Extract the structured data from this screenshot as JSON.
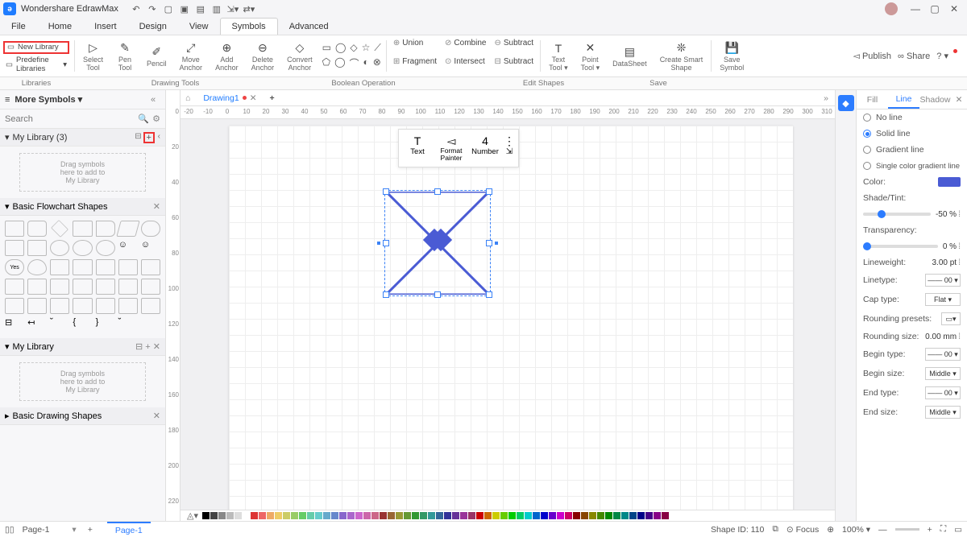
{
  "app": {
    "title": "Wondershare EdrawMax"
  },
  "menus": [
    "File",
    "Home",
    "Insert",
    "Design",
    "View",
    "Symbols",
    "Advanced"
  ],
  "active_menu": "Symbols",
  "publish": {
    "publish": "Publish",
    "share": "Share"
  },
  "libleft": {
    "new": "New Library",
    "predef": "Predefine Libraries",
    "label": "Libraries"
  },
  "drawing_tools": {
    "section": "Drawing Tools",
    "items": [
      {
        "icon": "▷",
        "l1": "Select",
        "l2": "Tool"
      },
      {
        "icon": "✎",
        "l1": "Pen",
        "l2": "Tool"
      },
      {
        "icon": "✐",
        "l1": "Pencil",
        "l2": ""
      },
      {
        "icon": "⤢",
        "l1": "Move",
        "l2": "Anchor"
      },
      {
        "icon": "⊕",
        "l1": "Add",
        "l2": "Anchor"
      },
      {
        "icon": "⊖",
        "l1": "Delete",
        "l2": "Anchor"
      },
      {
        "icon": "◇",
        "l1": "Convert",
        "l2": "Anchor"
      }
    ],
    "shapes_row1": [
      "▭",
      "◯",
      "◇",
      "☆",
      "⟋"
    ],
    "shapes_row2": [
      "⬠",
      "◯",
      "⌒",
      "◐",
      "⊗"
    ]
  },
  "boolean": {
    "section": "Boolean Operation",
    "items": [
      {
        "icon": "⊕",
        "label": "Union"
      },
      {
        "icon": "⊘",
        "label": "Combine"
      },
      {
        "icon": "⊖",
        "label": "Subtract"
      },
      {
        "icon": "⊞",
        "label": "Fragment"
      },
      {
        "icon": "⊙",
        "label": "Intersect"
      },
      {
        "icon": "⊟",
        "label": "Subtract"
      }
    ]
  },
  "edit_shapes": {
    "section": "Edit Shapes",
    "items": [
      {
        "icon": "T",
        "l1": "Text",
        "l2": "Tool ▾"
      },
      {
        "icon": "✕",
        "l1": "Point",
        "l2": "Tool ▾"
      },
      {
        "icon": "▤",
        "l1": "DataSheet",
        "l2": ""
      },
      {
        "icon": "❊",
        "l1": "Create Smart",
        "l2": "Shape"
      }
    ]
  },
  "save_section": {
    "section": "Save",
    "icon": "💾",
    "l1": "Save",
    "l2": "Symbol"
  },
  "left": {
    "more": "More Symbols ▾",
    "search_ph": "Search",
    "mylib": "My Library (3)",
    "drag": [
      "Drag symbols",
      "here to add to",
      "My Library"
    ],
    "basic": "Basic Flowchart Shapes",
    "mylib2": "My Library",
    "basic2": "Basic Drawing Shapes"
  },
  "tabs": {
    "drawing": "Drawing1"
  },
  "hruler_ticks": [
    -20,
    -10,
    0,
    10,
    20,
    30,
    40,
    50,
    60,
    70,
    80,
    90,
    100,
    110,
    120,
    130,
    140,
    150,
    160,
    170,
    180,
    190,
    200,
    210,
    220,
    230,
    240,
    250,
    260,
    270,
    280,
    290,
    300,
    310
  ],
  "vruler_ticks": [
    0,
    20,
    40,
    60,
    80,
    100,
    120,
    140,
    160,
    180,
    200,
    220
  ],
  "float": {
    "text": "Text",
    "format": "Format Painter",
    "number": "Number",
    "val": "4"
  },
  "right": {
    "tabs": [
      "Fill",
      "Line",
      "Shadow"
    ],
    "active": "Line",
    "noline": "No line",
    "solid": "Solid line",
    "grad": "Gradient line",
    "sgrad": "Single color gradient line",
    "color": "Color:",
    "shade": "Shade/Tint:",
    "shade_val": "-50 %",
    "trans": "Transparency:",
    "trans_val": "0 %",
    "lw": "Lineweight:",
    "lw_val": "3.00 pt",
    "lt": "Linetype:",
    "lt_val": "—— 00 ▾",
    "cap": "Cap type:",
    "cap_val": "Flat      ▾",
    "rp": "Rounding presets:",
    "rs": "Rounding size:",
    "rs_val": "0.00 mm",
    "bt": "Begin type:",
    "bt_val": "—— 00 ▾",
    "bs": "Begin size:",
    "bs_val": "Middle  ▾",
    "et": "End type:",
    "et_val": "—— 00 ▾",
    "es": "End size:",
    "es_val": "Middle  ▾"
  },
  "status": {
    "page": "Page-1",
    "page2": "Page-1",
    "shapeid": "Shape ID: 110",
    "focus": "Focus",
    "zoom": "100% ▾"
  },
  "color_palette": [
    "#000",
    "#444",
    "#888",
    "#bbb",
    "#ddd",
    "#fff",
    "#d33",
    "#e66",
    "#ea6",
    "#ec6",
    "#cc6",
    "#9c6",
    "#6c6",
    "#6ca",
    "#6cc",
    "#6ac",
    "#68c",
    "#86c",
    "#a6c",
    "#c6c",
    "#c6a",
    "#c68",
    "#933",
    "#963",
    "#993",
    "#693",
    "#393",
    "#396",
    "#399",
    "#369",
    "#339",
    "#639",
    "#939",
    "#936",
    "#c00",
    "#c60",
    "#cc0",
    "#6c0",
    "#0c0",
    "#0c6",
    "#0cc",
    "#06c",
    "#00c",
    "#60c",
    "#c0c",
    "#c06",
    "#800",
    "#840",
    "#880",
    "#480",
    "#080",
    "#084",
    "#088",
    "#048",
    "#008",
    "#408",
    "#808",
    "#804"
  ]
}
